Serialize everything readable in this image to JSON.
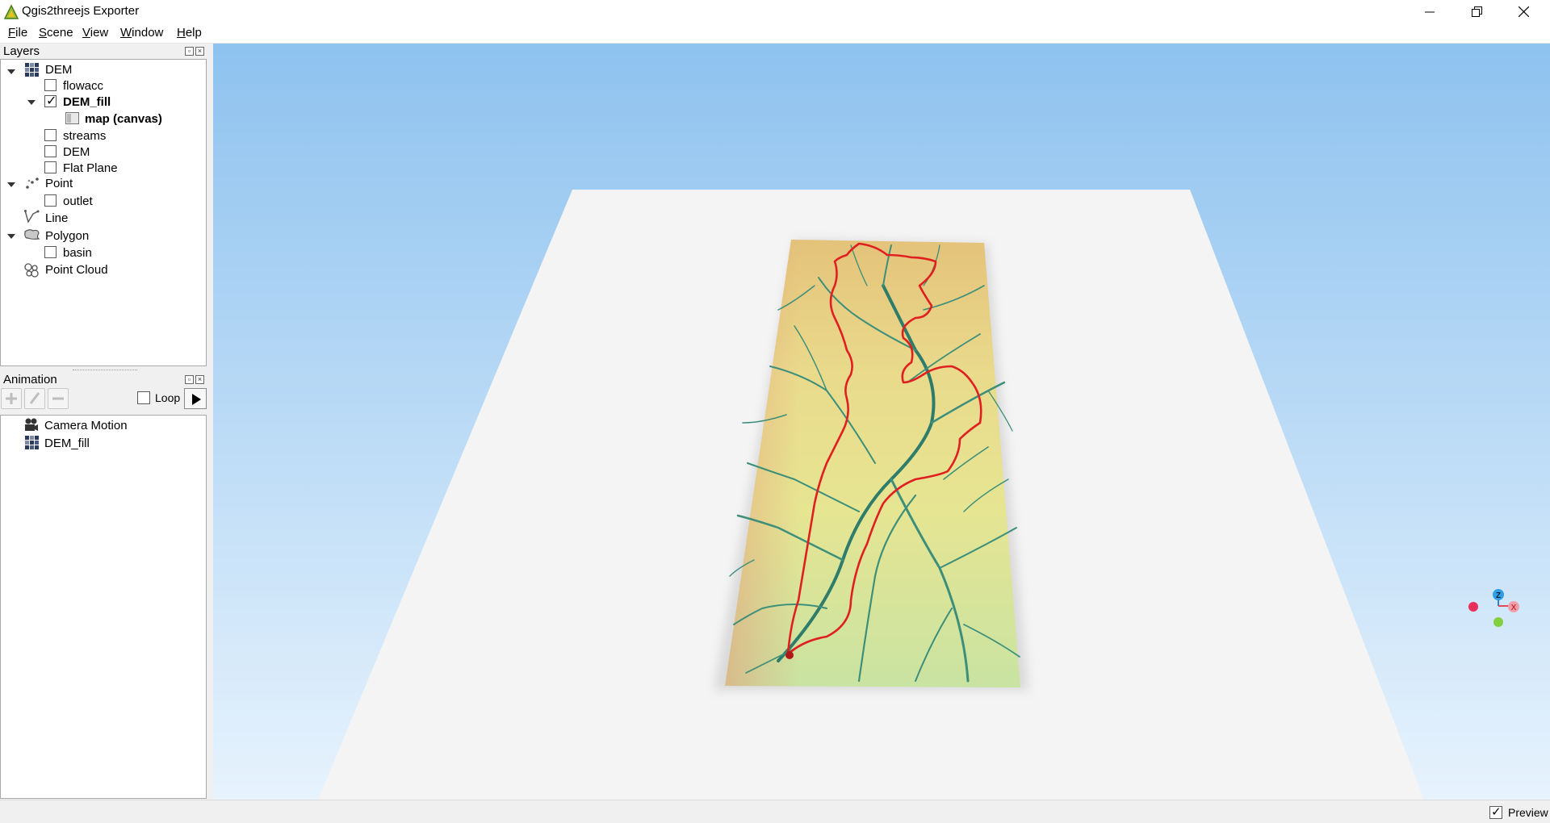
{
  "window": {
    "title": "Qgis2threejs Exporter"
  },
  "menubar": {
    "items": [
      "File",
      "Scene",
      "View",
      "Window",
      "Help"
    ]
  },
  "layers_panel": {
    "title": "Layers",
    "rows": [
      {
        "label": "DEM",
        "kind": "group",
        "expanded": true
      },
      {
        "label": "flowacc",
        "checked": false
      },
      {
        "label": "DEM_fill",
        "checked": true,
        "expanded": true,
        "bold": true
      },
      {
        "label": "map (canvas)",
        "bold": true
      },
      {
        "label": "streams",
        "checked": false
      },
      {
        "label": "DEM",
        "checked": false
      },
      {
        "label": "Flat Plane",
        "checked": false
      },
      {
        "label": "Point",
        "kind": "group",
        "expanded": true
      },
      {
        "label": "outlet",
        "checked": false
      },
      {
        "label": "Line",
        "kind": "group"
      },
      {
        "label": "Polygon",
        "kind": "group",
        "expanded": true
      },
      {
        "label": "basin",
        "checked": false
      },
      {
        "label": "Point Cloud",
        "kind": "group"
      }
    ]
  },
  "animation_panel": {
    "title": "Animation",
    "loop_label": "Loop",
    "loop_checked": false,
    "items": [
      {
        "label": "Camera Motion",
        "icon": "camera-icon"
      },
      {
        "label": "DEM_fill",
        "icon": "dem-icon"
      }
    ]
  },
  "viewport": {
    "sky_top_color": "#8ec2ef",
    "sky_bottom_color": "#e7f3fd",
    "plane_color": "#f4f4f4",
    "basin_outline_color": "#e02020",
    "axes": {
      "z": "Z",
      "x": "X"
    }
  },
  "statusbar": {
    "preview_label": "Preview",
    "preview_checked": true
  }
}
